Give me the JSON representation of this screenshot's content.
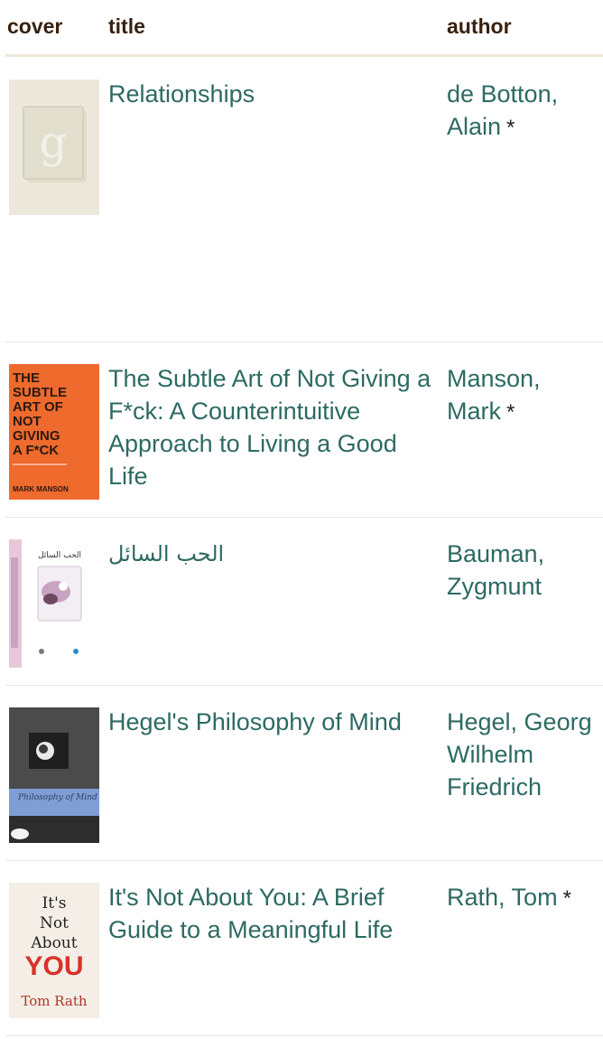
{
  "header": {
    "cover": "cover",
    "title": "title",
    "author": "author"
  },
  "books": [
    {
      "title": "Relationships",
      "author_line1": "de Botton,",
      "author_line2": "Alain",
      "author_star": "*",
      "cover": {
        "type": "placeholder",
        "letter": "g",
        "bg": "#ece9dc"
      }
    },
    {
      "title": "The Subtle Art of Not Giving a F*ck: A Counterintuitive Approach to Living a Good Life",
      "author_line1": "Manson,",
      "author_line2": "Mark",
      "author_star": "*",
      "cover": {
        "type": "subtle-art",
        "bg": "#ee6a2d",
        "lines": [
          "THE",
          "SUBTLE",
          "ART OF",
          "NOT",
          "GIVING",
          "A F*CK"
        ],
        "footer": "MARK MANSON"
      }
    },
    {
      "title": "الحب السائل",
      "author_line1": "Bauman,",
      "author_line2": "Zygmunt",
      "author_star": "",
      "cover": {
        "type": "liquid-love",
        "bg": "#ffffff",
        "heading": "الحب السائل"
      }
    },
    {
      "title": "Hegel's Philosophy of Mind",
      "author_line1": "Hegel, Georg",
      "author_line2": "Wilhelm",
      "author_line3": "Friedrich",
      "author_star": "",
      "cover": {
        "type": "hegel",
        "bg": "#3a3a3a",
        "band": "#7f9ed3",
        "band_text": "Philosophy of Mind"
      }
    },
    {
      "title": "It's Not About You: A Brief Guide to a Meaningful Life",
      "author_line1": "Rath, Tom",
      "author_star": "*",
      "cover": {
        "type": "not-about-you",
        "bg": "#f4eee6",
        "line1": "It's",
        "line2": "Not",
        "line3": "About",
        "big": "YOU",
        "author": "Tom Rath"
      }
    }
  ]
}
